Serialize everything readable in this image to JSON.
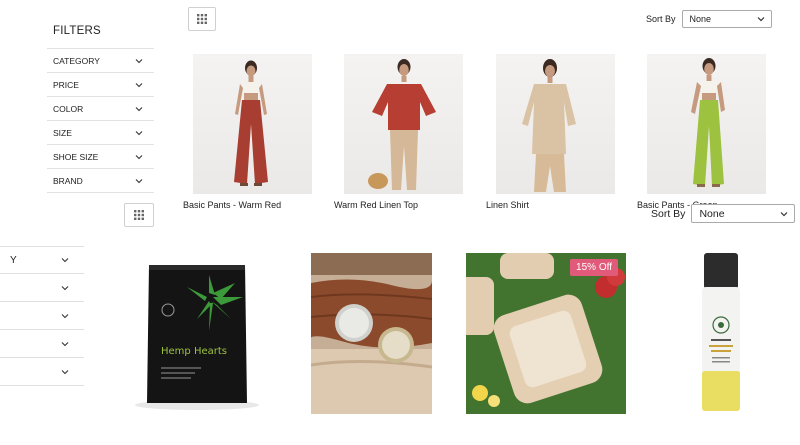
{
  "top": {
    "filters_title": "FILTERS",
    "filters": [
      "CATEGORY",
      "PRICE",
      "COLOR",
      "SIZE",
      "SHOE SIZE",
      "BRAND"
    ],
    "sort_label": "Sort By",
    "sort_value": "None",
    "products": [
      {
        "name": "Basic Pants - Warm Red"
      },
      {
        "name": "Warm Red Linen Top"
      },
      {
        "name": "Linen Shirt"
      },
      {
        "name": "Basic Pants - Green"
      }
    ]
  },
  "bottom": {
    "filters": [
      "Y",
      "",
      "",
      "",
      ""
    ],
    "sort_label": "Sort By",
    "sort_value": "None",
    "products": [
      {
        "package_text": "Hemp Hearts"
      },
      {},
      {
        "badge": "15% Off"
      },
      {}
    ]
  },
  "colors": {
    "border": "#e2e2e2",
    "badge": "#e15a7a",
    "red": "#b8433a",
    "green": "#9cc23f",
    "beige": "#d8bf9d"
  },
  "icons": [
    "grid-view-icon",
    "chevron-down-icon"
  ]
}
